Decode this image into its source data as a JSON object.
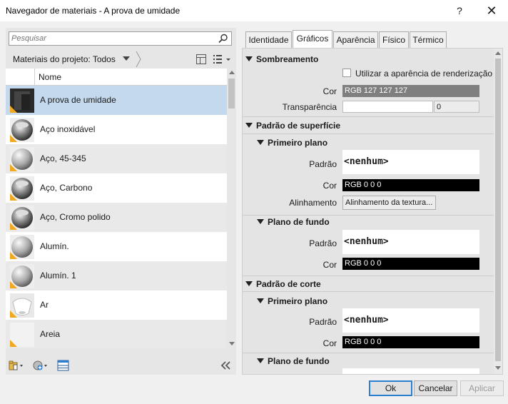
{
  "window": {
    "title": "Navegador de materiais - A prova de umidade",
    "help": "?",
    "close": "✕"
  },
  "search": {
    "placeholder": "Pesquisar"
  },
  "library": {
    "breadcrumb": "Materiais do projeto: Todos"
  },
  "list": {
    "column_header": "Nome",
    "items": [
      {
        "label": "A prova de umidade",
        "thumb": "dark"
      },
      {
        "label": "Aço inoxidável",
        "thumb": "chrome"
      },
      {
        "label": "Aço, 45-345",
        "thumb": "sphere"
      },
      {
        "label": "Aço, Carbono",
        "thumb": "chrome"
      },
      {
        "label": "Aço, Cromo polido",
        "thumb": "chrome"
      },
      {
        "label": "Alumín.",
        "thumb": "sphere"
      },
      {
        "label": "Alumín. 1",
        "thumb": "sphere"
      },
      {
        "label": "Ar",
        "thumb": "air"
      },
      {
        "label": "Areia",
        "thumb": "sand"
      },
      {
        "label": "",
        "thumb": "sphere"
      }
    ]
  },
  "tabs": [
    "Identidade",
    "Gráficos",
    "Aparência",
    "Físico",
    "Térmico"
  ],
  "graphics": {
    "shading": {
      "title": "Sombreamento",
      "use_render_label": "Utilizar a aparência de renderização",
      "color_label": "Cor",
      "color_value": "RGB 127 127 127",
      "transparency_label": "Transparência",
      "transparency_value": "0"
    },
    "surface": {
      "title": "Padrão de superfície",
      "foreground": {
        "title": "Primeiro plano",
        "pattern_label": "Padrão",
        "pattern_value": "<nenhum>",
        "color_label": "Cor",
        "color_value": "RGB 0 0 0",
        "align_label": "Alinhamento",
        "align_button": "Alinhamento da textura..."
      },
      "background": {
        "title": "Plano de fundo",
        "pattern_label": "Padrão",
        "pattern_value": "<nenhum>",
        "color_label": "Cor",
        "color_value": "RGB 0 0 0"
      }
    },
    "cut": {
      "title": "Padrão de corte",
      "foreground": {
        "title": "Primeiro plano",
        "pattern_label": "Padrão",
        "pattern_value": "<nenhum>",
        "color_label": "Cor",
        "color_value": "RGB 0 0 0"
      },
      "background": {
        "title": "Plano de fundo"
      }
    }
  },
  "buttons": {
    "ok": "Ok",
    "cancel": "Cancelar",
    "apply": "Aplicar"
  },
  "colors": {
    "selected_row": "#c4d9ee",
    "shading_swatch": "#7f7f7f",
    "black_swatch": "#000000",
    "primary_border": "#2a7fd4"
  }
}
